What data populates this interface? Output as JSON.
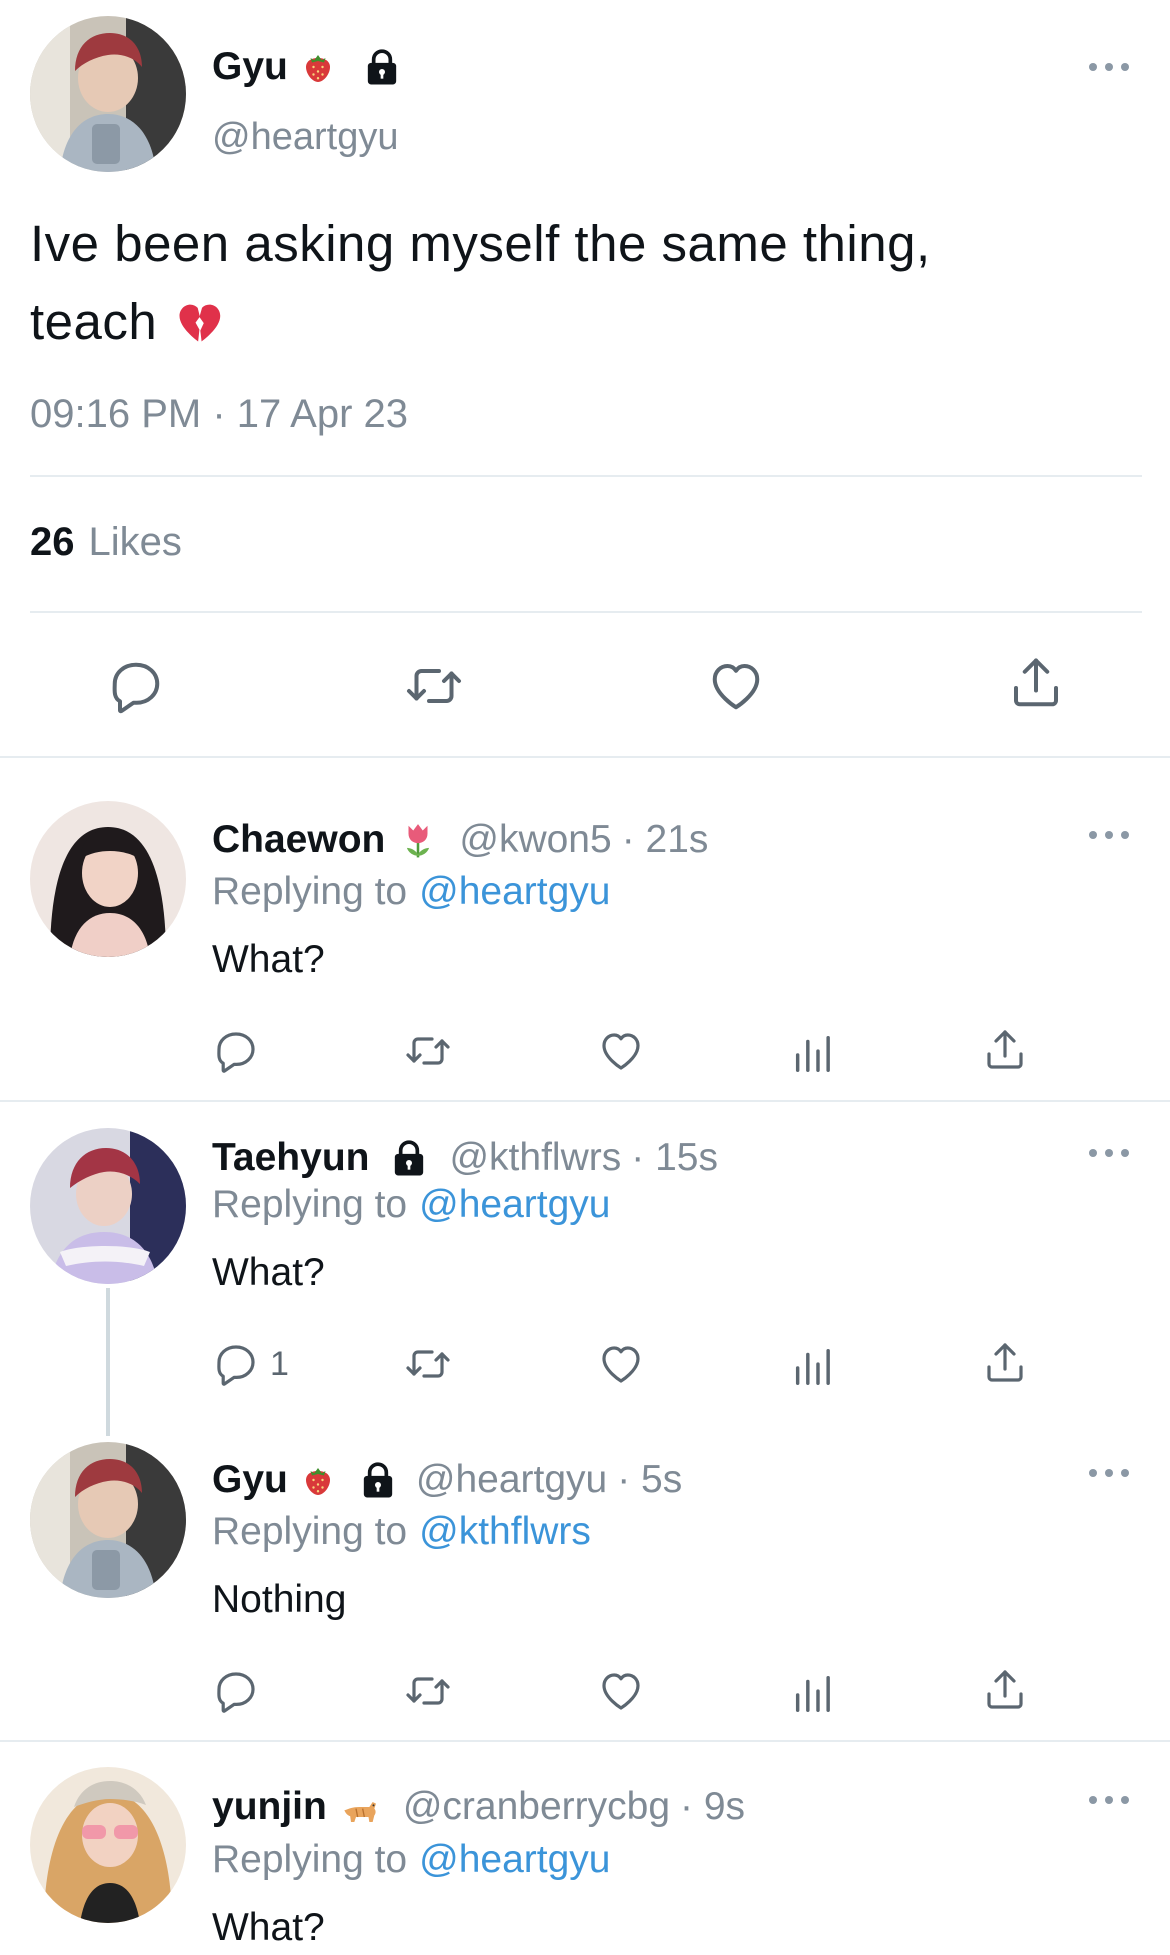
{
  "main_tweet": {
    "display_name": "Gyu",
    "handle": "@heartgyu",
    "text_line1": "Ive been asking myself the same thing,",
    "text_line2": "teach",
    "timestamp": "09:16 PM · 17 Apr 23",
    "likes_count": "26",
    "likes_label": "Likes"
  },
  "replies": [
    {
      "display_name": "Chaewon",
      "handle": "@kwon5",
      "time": "· 21s",
      "replying_prefix": "Replying to",
      "replying_to": "@heartgyu",
      "text": "What?",
      "reply_count": ""
    },
    {
      "display_name": "Taehyun",
      "handle": "@kthflwrs",
      "time": "· 15s",
      "replying_prefix": "Replying to",
      "replying_to": "@heartgyu",
      "text": "What?",
      "reply_count": "1"
    },
    {
      "display_name": "Gyu",
      "handle": "@heartgyu",
      "time": "· 5s",
      "replying_prefix": "Replying to",
      "replying_to": "@kthflwrs",
      "text": "Nothing",
      "reply_count": ""
    },
    {
      "display_name": "yunjin",
      "handle": "@cranberrycbg",
      "time": "· 9s",
      "replying_prefix": "Replying to",
      "replying_to": "@heartgyu",
      "text": "What?",
      "reply_count": ""
    }
  ],
  "icons": {
    "reply": "reply-icon",
    "retweet": "retweet-icon",
    "like": "heart-icon",
    "share": "share-icon",
    "views": "views-icon",
    "more": "more-icon",
    "lock": "lock-icon",
    "strawberry": "strawberry-icon",
    "tulip": "tulip-icon",
    "cat": "cat-icon",
    "broken_heart": "broken-heart-icon"
  },
  "colors": {
    "text": "#0f1419",
    "secondary": "#7f8a95",
    "link": "#3b94d9",
    "divider": "#e6ecf0"
  }
}
